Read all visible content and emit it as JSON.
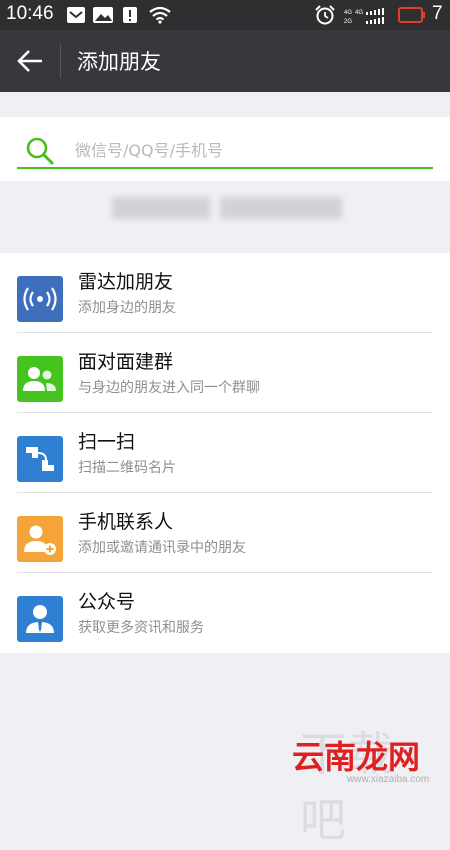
{
  "status_bar": {
    "time": "10:46",
    "battery": "7",
    "network_labels": [
      "4G",
      "4G",
      "2G"
    ]
  },
  "app_bar": {
    "title": "添加朋友",
    "back_icon": "arrow-left-icon"
  },
  "search": {
    "placeholder": "微信号/QQ号/手机号",
    "icon": "search-icon",
    "accent_color": "#45c01a"
  },
  "list": [
    {
      "label": "雷达加朋友",
      "sub": "添加身边的朋友",
      "icon": "radar-icon",
      "color": "#3e6fbd"
    },
    {
      "label": "面对面建群",
      "sub": "与身边的朋友进入同一个群聊",
      "icon": "group-icon",
      "color": "#45c41f"
    },
    {
      "label": "扫一扫",
      "sub": "扫描二维码名片",
      "icon": "scan-icon",
      "color": "#2f7fd2"
    },
    {
      "label": "手机联系人",
      "sub": "添加或邀请通讯录中的朋友",
      "icon": "contact-add-icon",
      "color": "#f5a43a"
    },
    {
      "label": "公众号",
      "sub": "获取更多资讯和服务",
      "icon": "official-account-icon",
      "color": "#2f7fd2"
    }
  ],
  "watermark": {
    "big": "下载吧",
    "main": "云南龙网",
    "url": "www.xiazaiba.com"
  }
}
